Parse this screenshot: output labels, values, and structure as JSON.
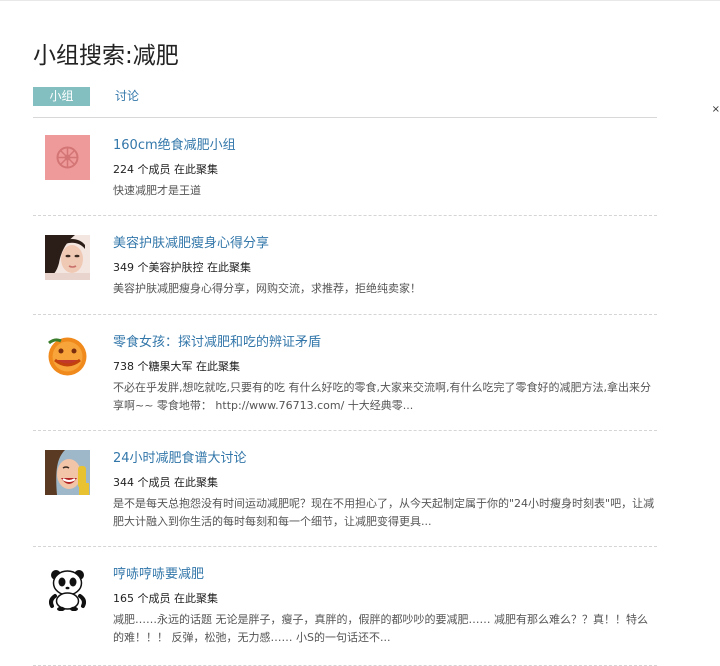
{
  "page": {
    "title": "小组搜索:减肥"
  },
  "tabs": [
    {
      "label": "小组",
      "active": true
    },
    {
      "label": "讨论",
      "active": false
    }
  ],
  "groups": [
    {
      "name": "160cm绝食减肥小组",
      "members": "224 个成员 在此聚集",
      "description": "快速减肥才是王道",
      "icon": "pink-wheel-logo"
    },
    {
      "name": "美容护肤减肥瘦身心得分享",
      "members": "349 个美容护肤控 在此聚集",
      "description": "美容护肤减肥瘦身心得分享，网购交流，求推荐，拒绝纯卖家！",
      "icon": "woman-face-photo"
    },
    {
      "name": "零食女孩：探讨减肥和吃的辨证矛盾",
      "members": "738 个糖果大军 在此聚集",
      "description": "不必在乎发胖,想吃就吃,只要有的吃 有什么好吃的零食,大家来交流啊,有什么吃完了零食好的减肥方法,拿出来分享啊~~ 零食地带： http://www.76713.com/ 十大经典零...",
      "icon": "orange-slice-photo"
    },
    {
      "name": "24小时减肥食谱大讨论",
      "members": "344 个成员 在此聚集",
      "description": "是不是每天总抱怨没有时间运动减肥呢？现在不用担心了，从今天起制定属于你的\"24小时瘦身时刻表\"吧，让减肥大计融入到你生活的每时每刻和每一个细节，让减肥变得更具...",
      "icon": "laughing-girl-phone-photo"
    },
    {
      "name": "哼哧哼哧要减肥",
      "members": "165 个成员 在此聚集",
      "description": "减肥……永远的话题 无论是胖子，瘦子，真胖的，假胖的都吵吵的要减肥…… 减肥有那么难么？？真！！特么的难！！！ 反弹，松弛，无力感…… 小S的一句话还不...",
      "icon": "panda-cartoon"
    }
  ]
}
